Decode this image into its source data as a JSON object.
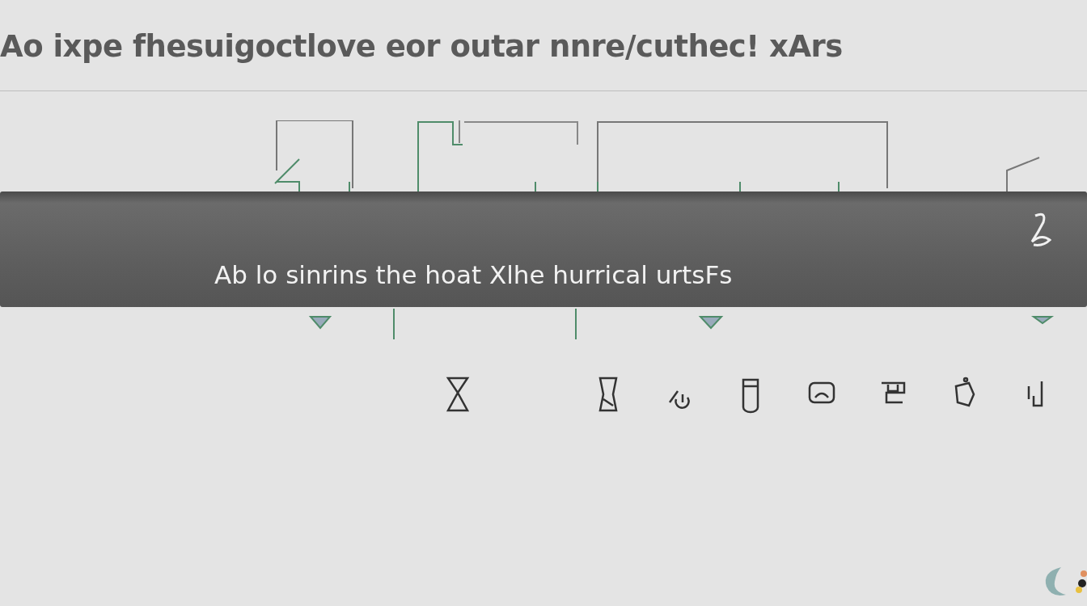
{
  "title": "Ao ixpe fhesuigoctlove eor outar nnre/cuthec! xArs",
  "banner": {
    "text": "Ab lo sinrins the hoat Xlhe hurrical urtsFs"
  }
}
